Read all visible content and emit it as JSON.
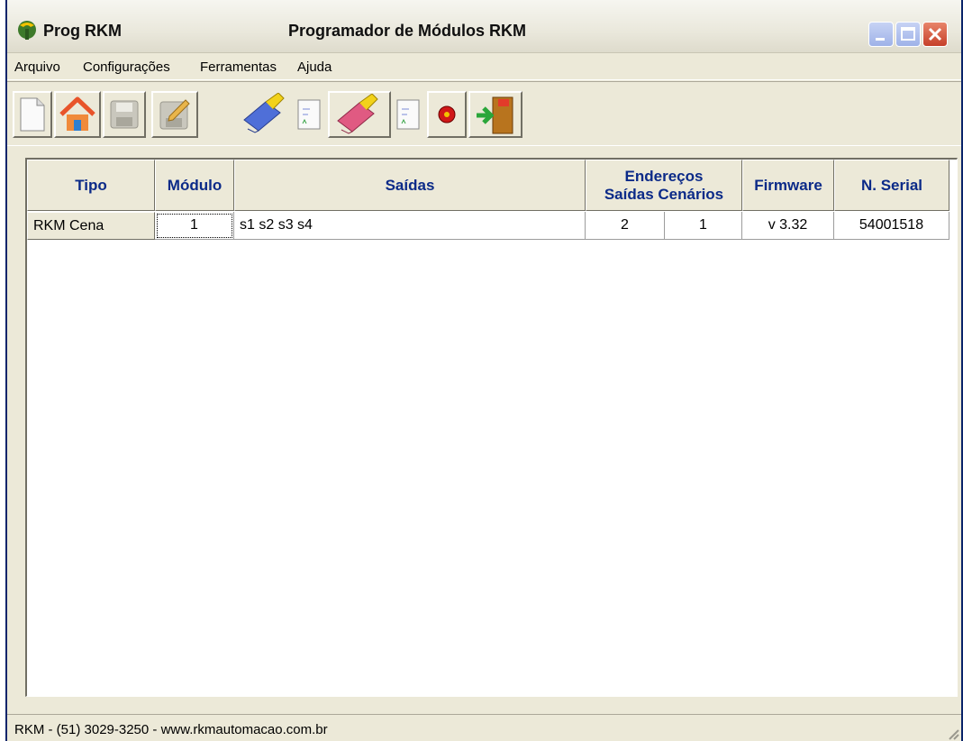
{
  "window": {
    "app_name": "Prog RKM",
    "title": "Programador de Módulos RKM"
  },
  "menu": [
    "Arquivo",
    "Configurações",
    "Ferramentas",
    "Ajuda"
  ],
  "toolbar": {
    "buttons": [
      "new-document-icon",
      "home-icon",
      "save-disk-icon",
      "save-edit-icon",
      "program-module-blue-icon",
      "document-preview-icon",
      "program-module-pink-icon",
      "document-preview-icon",
      "stop-red-icon",
      "exit-door-icon"
    ]
  },
  "grid": {
    "headers": {
      "tipo": "Tipo",
      "modulo": "Módulo",
      "saidas": "Saídas",
      "enderecos": "Endereços",
      "enderecos_saidas": "Saídas",
      "enderecos_cenarios": "Cenários",
      "firmware": "Firmware",
      "serial": "N. Serial"
    },
    "rows": [
      {
        "tipo": "RKM Cena",
        "modulo": "1",
        "saidas": "s1 s2 s3 s4",
        "end_saidas": "2",
        "end_cenarios": "1",
        "firmware": "v 3.32",
        "serial": "54001518"
      }
    ]
  },
  "status": {
    "text": "RKM - (51) 3029-3250  - www.rkmautomacao.com.br"
  },
  "colors": {
    "header_text": "#0b2a88",
    "window_bg": "#ece9d8",
    "close_button": "#c6402a"
  }
}
